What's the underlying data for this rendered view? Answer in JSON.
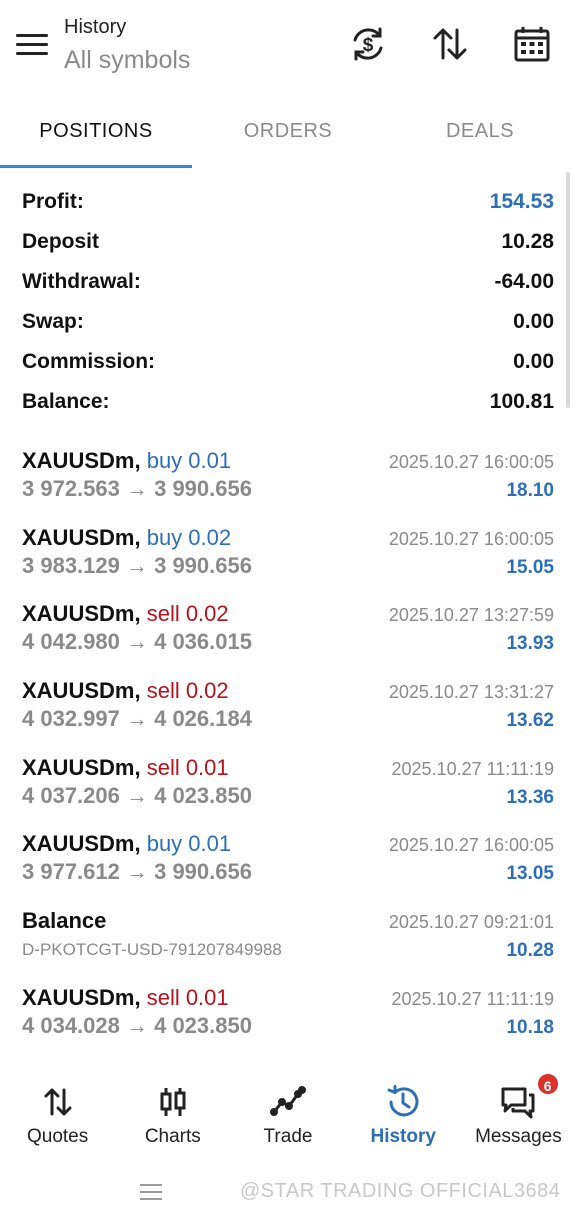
{
  "header": {
    "title_small": "History",
    "title_large": "All symbols"
  },
  "tabs": [
    {
      "label": "POSITIONS",
      "active": true
    },
    {
      "label": "ORDERS",
      "active": false
    },
    {
      "label": "DEALS",
      "active": false
    }
  ],
  "summary": [
    {
      "label": "Profit:",
      "value": "154.53",
      "color": "#2d6fb7"
    },
    {
      "label": "Deposit",
      "value": "10.28"
    },
    {
      "label": "Withdrawal:",
      "value": "-64.00"
    },
    {
      "label": "Swap:",
      "value": "0.00"
    },
    {
      "label": "Commission:",
      "value": "0.00"
    },
    {
      "label": "Balance:",
      "value": "100.81"
    }
  ],
  "deals": [
    {
      "symbol": "XAUUSDm,",
      "side": "buy 0.01",
      "side_type": "buy",
      "time": "2025.10.27 16:00:05",
      "prices": "3 972.563 → 3 990.656",
      "profit": "18.10"
    },
    {
      "symbol": "XAUUSDm,",
      "side": "buy 0.02",
      "side_type": "buy",
      "time": "2025.10.27 16:00:05",
      "prices": "3 983.129 → 3 990.656",
      "profit": "15.05"
    },
    {
      "symbol": "XAUUSDm,",
      "side": "sell 0.02",
      "side_type": "sell",
      "time": "2025.10.27 13:27:59",
      "prices": "4 042.980 → 4 036.015",
      "profit": "13.93"
    },
    {
      "symbol": "XAUUSDm,",
      "side": "sell 0.02",
      "side_type": "sell",
      "time": "2025.10.27 13:31:27",
      "prices": "4 032.997 → 4 026.184",
      "profit": "13.62"
    },
    {
      "symbol": "XAUUSDm,",
      "side": "sell 0.01",
      "side_type": "sell",
      "time": "2025.10.27 11:11:19",
      "prices": "4 037.206 → 4 023.850",
      "profit": "13.36"
    },
    {
      "symbol": "XAUUSDm,",
      "side": "buy 0.01",
      "side_type": "buy",
      "time": "2025.10.27 16:00:05",
      "prices": "3 977.612 → 3 990.656",
      "profit": "13.05"
    },
    {
      "symbol": "Balance",
      "side": "",
      "side_type": "balance",
      "time": "2025.10.27 09:21:01",
      "sub": "D-PKOTCGT-USD-791207849988",
      "profit": "10.28"
    },
    {
      "symbol": "XAUUSDm,",
      "side": "sell 0.01",
      "side_type": "sell",
      "time": "2025.10.27 11:11:19",
      "prices": "4 034.028 → 4 023.850",
      "profit": "10.18"
    }
  ],
  "bottom_nav": [
    {
      "label": "Quotes",
      "icon": "quotes-icon",
      "active": false
    },
    {
      "label": "Charts",
      "icon": "charts-icon",
      "active": false
    },
    {
      "label": "Trade",
      "icon": "trade-icon",
      "active": false
    },
    {
      "label": "History",
      "icon": "history-icon",
      "active": true
    },
    {
      "label": "Messages",
      "icon": "messages-icon",
      "active": false,
      "badge": "6"
    }
  ],
  "watermark": "@STAR TRADING OFFICIAL3684",
  "colors": {
    "accent": "#2d6fb7",
    "sell": "#b5121b",
    "tab_indicator": "#3b83d6",
    "badge": "#d9322a"
  }
}
